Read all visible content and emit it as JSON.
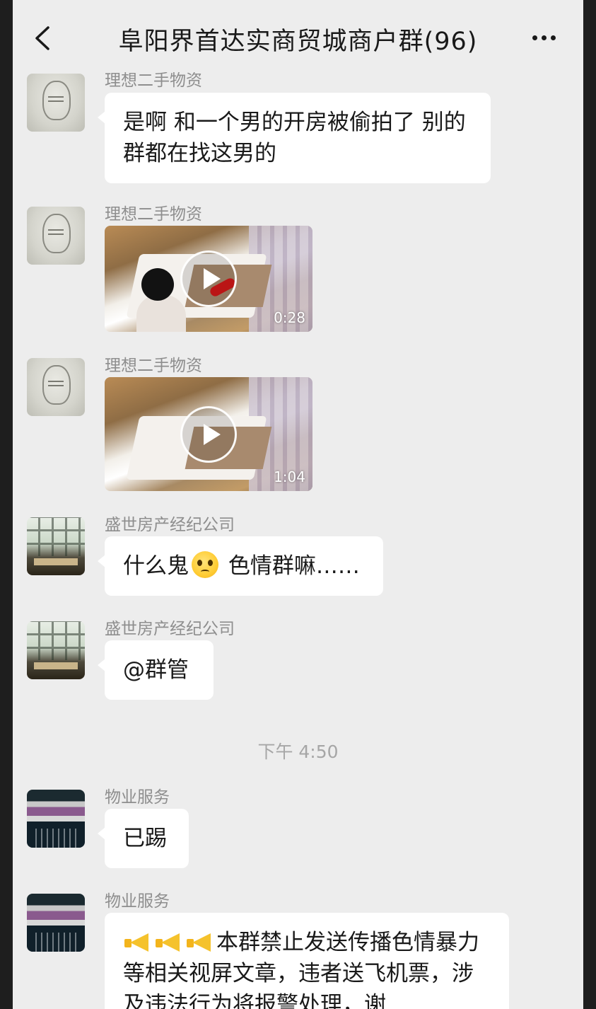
{
  "header": {
    "title": "阜阳界首达实商贸城商户群(96)"
  },
  "messages": [
    {
      "sender": "理想二手物资",
      "text": "是啊 和一个男的开房被偷拍了 别的群都在找这男的"
    },
    {
      "sender": "理想二手物资",
      "video_duration": "0:28"
    },
    {
      "sender": "理想二手物资",
      "video_duration": "1:04"
    },
    {
      "sender": "盛世房产经纪公司",
      "text_before": "什么鬼",
      "text_after": " 色情群嘛……",
      "emoji": "pleading-face-emoji"
    },
    {
      "sender": "盛世房产经纪公司",
      "text": "@群管"
    },
    {
      "sender": "物业服务",
      "text": "已踢"
    },
    {
      "sender": "物业服务",
      "text": "本群禁止发送传播色情暴力等相关视屏文章，违者送飞机票，涉及违法行为将报警处理，谢",
      "emoji": "megaphone-emoji"
    }
  ],
  "timestamp": "下午 4:50",
  "icons": {
    "back": "chevron-left-icon",
    "more": "more-dots-icon",
    "play": "play-icon"
  },
  "colors": {
    "background": "#ededed",
    "bubble": "#ffffff",
    "sender_text": "#8e8e8e",
    "timestamp_text": "#a6a6a6"
  }
}
